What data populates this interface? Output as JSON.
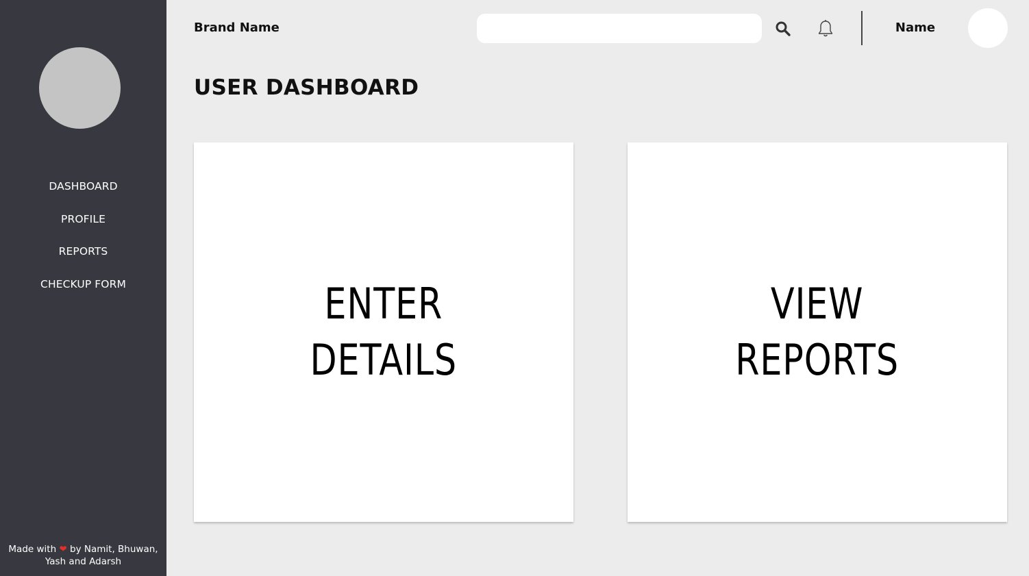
{
  "sidebar": {
    "items": [
      {
        "label": "DASHBOARD"
      },
      {
        "label": "PROFILE"
      },
      {
        "label": "REPORTS"
      },
      {
        "label": "CHECKUP FORM"
      }
    ],
    "footer": {
      "prefix": "Made with ",
      "heart": "❤",
      "suffix_line1": " by Namit, Bhuwan,",
      "line2": "Yash and Adarsh"
    }
  },
  "header": {
    "brand": "Brand Name",
    "search": {
      "value": "",
      "placeholder": ""
    },
    "user_name": "Name",
    "icons": {
      "search": "search-icon",
      "notifications": "bell-icon"
    }
  },
  "main": {
    "title": "USER DASHBOARD",
    "cards": [
      {
        "line1": "ENTER",
        "line2": "DETAILS"
      },
      {
        "line1": "VIEW",
        "line2": "REPORTS"
      }
    ]
  },
  "colors": {
    "sidebar_bg": "#383840",
    "page_bg": "#ececec",
    "card_bg": "#ffffff",
    "avatar_placeholder": "#c4c4c4"
  }
}
